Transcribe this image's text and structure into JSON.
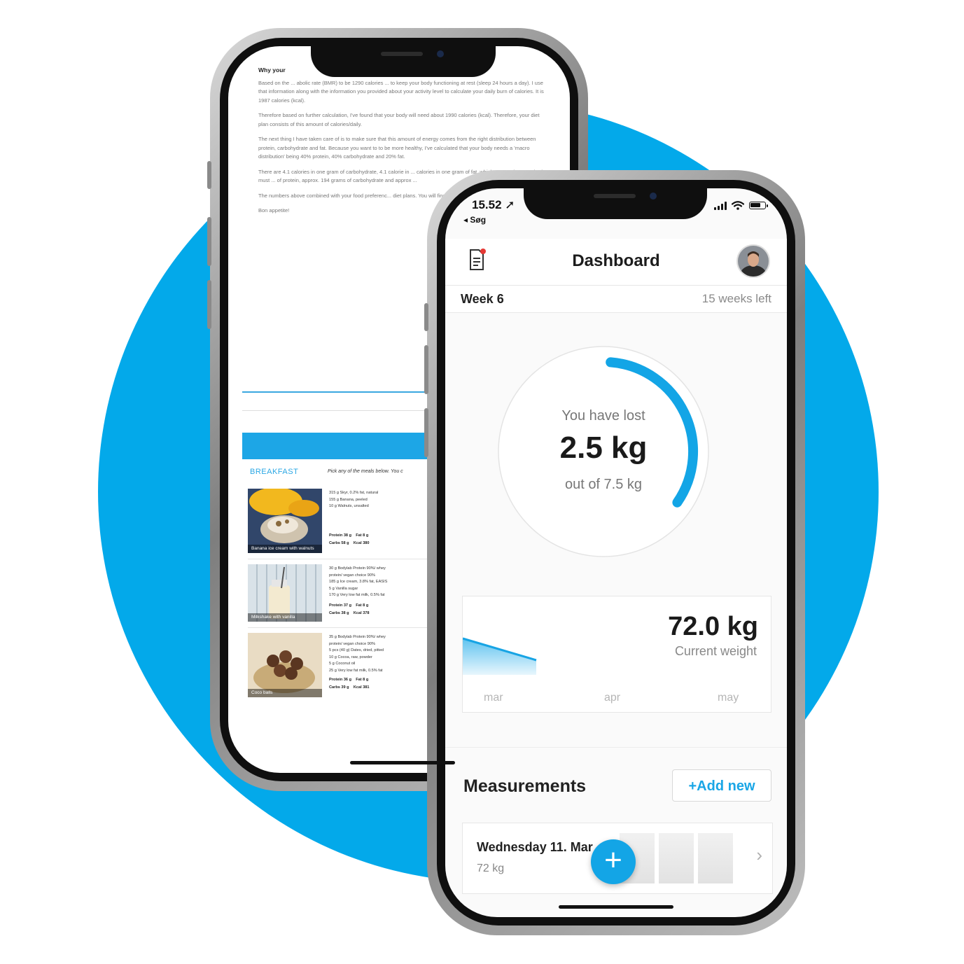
{
  "colors": {
    "accent": "#03a9ea",
    "progress_blue": "#13a5e6",
    "chart_fill": "#9bd8f3"
  },
  "back_doc": {
    "heading": "Why your",
    "paragraphs": [
      "Based on the ... abolic rate (BMR) to be 1290 calories ... to keep your body functioning at rest (sleep 24 hours a day). I use that information along with the information you provided about your activity level to calculate your daily burn of calories. It is 1987 calories (kcal).",
      "Therefore based on further calculation, I've found that your body will need about 1990 calories (kcal). Therefore, your diet plan consists of this amount of calories/daily.",
      "The next thing I have taken care of is to make sure that this amount of energy comes from the right distribution between protein, carbohydrate and fat. Because you want to to be more healthy, I've calculated that your body needs a 'macro distribution' being 40% protein, 40% carbohydrate and 20% fat.",
      "There are 4.1 calories in one gram of carbohydrate, 4.1 calorie in ... calories in one gram of fat, which means that your body must ... of protein, approx. 194 grams of carbohydrate and approx ...",
      "The numbers above combined with your food preferenc... diet plans. You will find them on the following pages.",
      "Bon appetite!"
    ],
    "breakfast_title": "BREAKFAST",
    "breakfast_note": "Pick any of the meals below. You c",
    "meals": [
      {
        "caption": "Banana ice cream with walnuts",
        "ingredients": "315 g Skyr, 0.2% fat, natural\n155 g Banana, peeled\n10 g Walnuts, unsalted",
        "macros": "Protein 38 g    Fat 8 g\nCarbs 58 g    Kcal 380"
      },
      {
        "caption": "Milkshake with vanilla",
        "ingredients": "30 g Bodylab Protein 90%/ whey\nprotein/ vegan choice 90%\n185 g Ice cream, 3.8% fat, EASIS\n5 g Vanilla sugar\n170 g Very low fat milk, 0.5% fat",
        "macros": "Protein 37 g    Fat 8 g\nCarbs 38 g    Kcal 378"
      },
      {
        "caption": "Coco balls",
        "ingredients": "35 g Bodylab Protein 90%/ whey\nprotein/ vegan choice 90%\n5 pcs (40 g) Dates, dried, pitted\n10 g Cocoa, raw, powder\n5 g Coconut oil\n25 g Very low fat milk, 0.5% fat",
        "macros": "Protein 36 g    Fat 8 g\nCarbs 39 g    Kcal 381"
      }
    ]
  },
  "status_bar": {
    "time": "15.52 ➚",
    "back": "◂ Søg"
  },
  "header": {
    "title": "Dashboard"
  },
  "week": {
    "label": "Week 6",
    "remaining": "15 weeks left"
  },
  "progress": {
    "label": "You have lost",
    "value": "2.5 kg",
    "total": "out of 7.5 kg",
    "lost_kg": 2.5,
    "goal_kg": 7.5
  },
  "weight": {
    "value": "72.0 kg",
    "caption": "Current weight",
    "months": [
      "mar",
      "apr",
      "may"
    ]
  },
  "measurements": {
    "title": "Measurements",
    "add_label": "+Add new",
    "entry": {
      "date": "Wednesday 11. Mar",
      "weight": "72 kg"
    }
  },
  "fab": {
    "label": "+"
  }
}
